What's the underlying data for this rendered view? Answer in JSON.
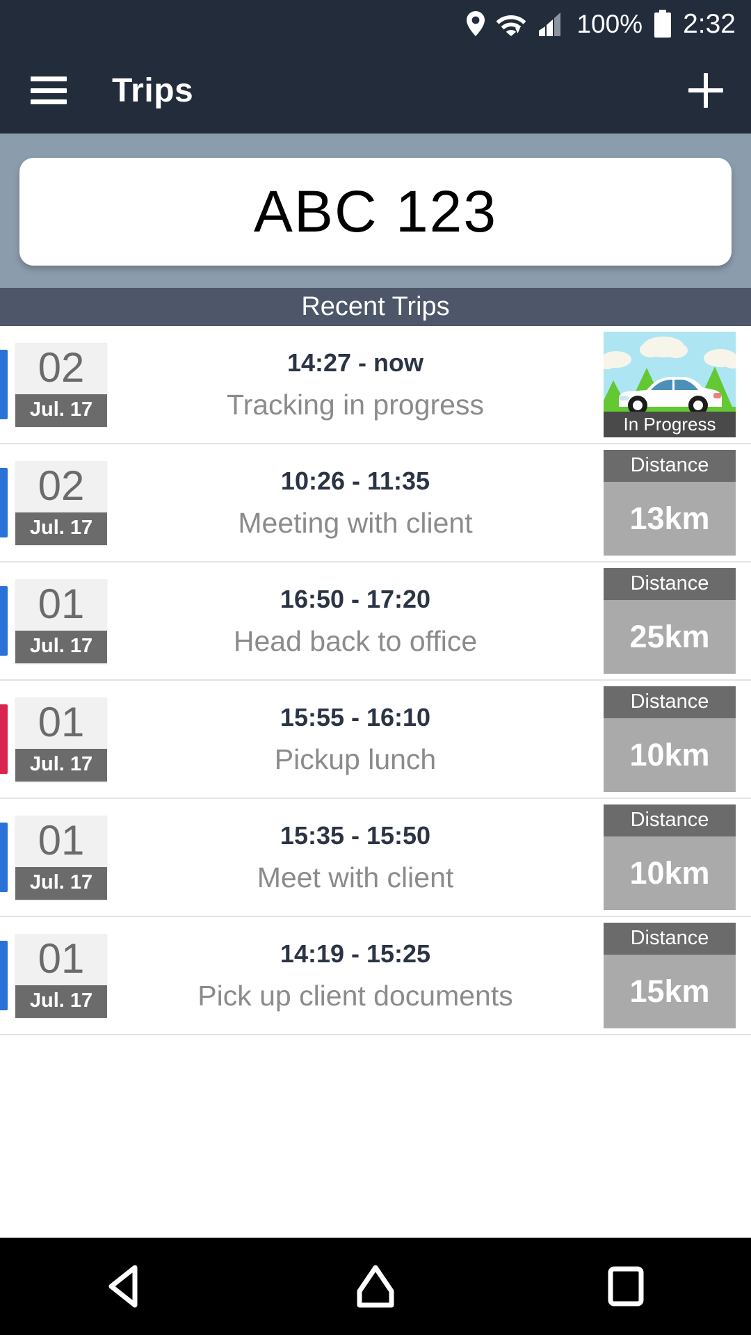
{
  "status_bar": {
    "icons": [
      "location-pin-icon",
      "wifi-icon",
      "cellular-signal-icon"
    ],
    "battery_percent": "100%",
    "battery_icon": "battery-full-icon",
    "clock": "2:32"
  },
  "app_bar": {
    "menu_icon": "hamburger-menu-icon",
    "title": "Trips",
    "add_icon": "plus-icon"
  },
  "plate": {
    "value": "ABC 123"
  },
  "section": {
    "title": "Recent Trips"
  },
  "colors": {
    "app_bar": "#232c3b",
    "banner": "#8b9cad",
    "section_header": "#4d5769",
    "accent_blue": "#2a72d8",
    "accent_red": "#d9254e",
    "badge_dark": "#6b6b6b",
    "badge_light": "#aaaaaa",
    "day_bg": "#f1f1f1",
    "time_text": "#2b3445",
    "desc_text": "#8b8b8b"
  },
  "distance_label": "Distance",
  "trips": [
    {
      "day": "02",
      "month": "Jul. 17",
      "time": "14:27 - now",
      "description": "Tracking in progress",
      "accent": "#2a72d8",
      "right_type": "thumbnail",
      "thumbnail_caption": "In Progress",
      "thumbnail_icon": "car-landscape-illustration"
    },
    {
      "day": "02",
      "month": "Jul. 17",
      "time": "10:26 - 11:35",
      "description": "Meeting with client",
      "accent": "#2a72d8",
      "right_type": "distance",
      "distance": "13km"
    },
    {
      "day": "01",
      "month": "Jul. 17",
      "time": "16:50 - 17:20",
      "description": "Head back to office",
      "accent": "#2a72d8",
      "right_type": "distance",
      "distance": "25km"
    },
    {
      "day": "01",
      "month": "Jul. 17",
      "time": "15:55 - 16:10",
      "description": "Pickup lunch",
      "accent": "#d9254e",
      "right_type": "distance",
      "distance": "10km"
    },
    {
      "day": "01",
      "month": "Jul. 17",
      "time": "15:35 - 15:50",
      "description": "Meet with client",
      "accent": "#2a72d8",
      "right_type": "distance",
      "distance": "10km"
    },
    {
      "day": "01",
      "month": "Jul. 17",
      "time": "14:19 - 15:25",
      "description": "Pick up client documents",
      "accent": "#2a72d8",
      "right_type": "distance",
      "distance": "15km"
    }
  ],
  "nav_bar": {
    "back": "back-triangle-icon",
    "home": "home-icon",
    "recents": "recents-square-icon"
  }
}
